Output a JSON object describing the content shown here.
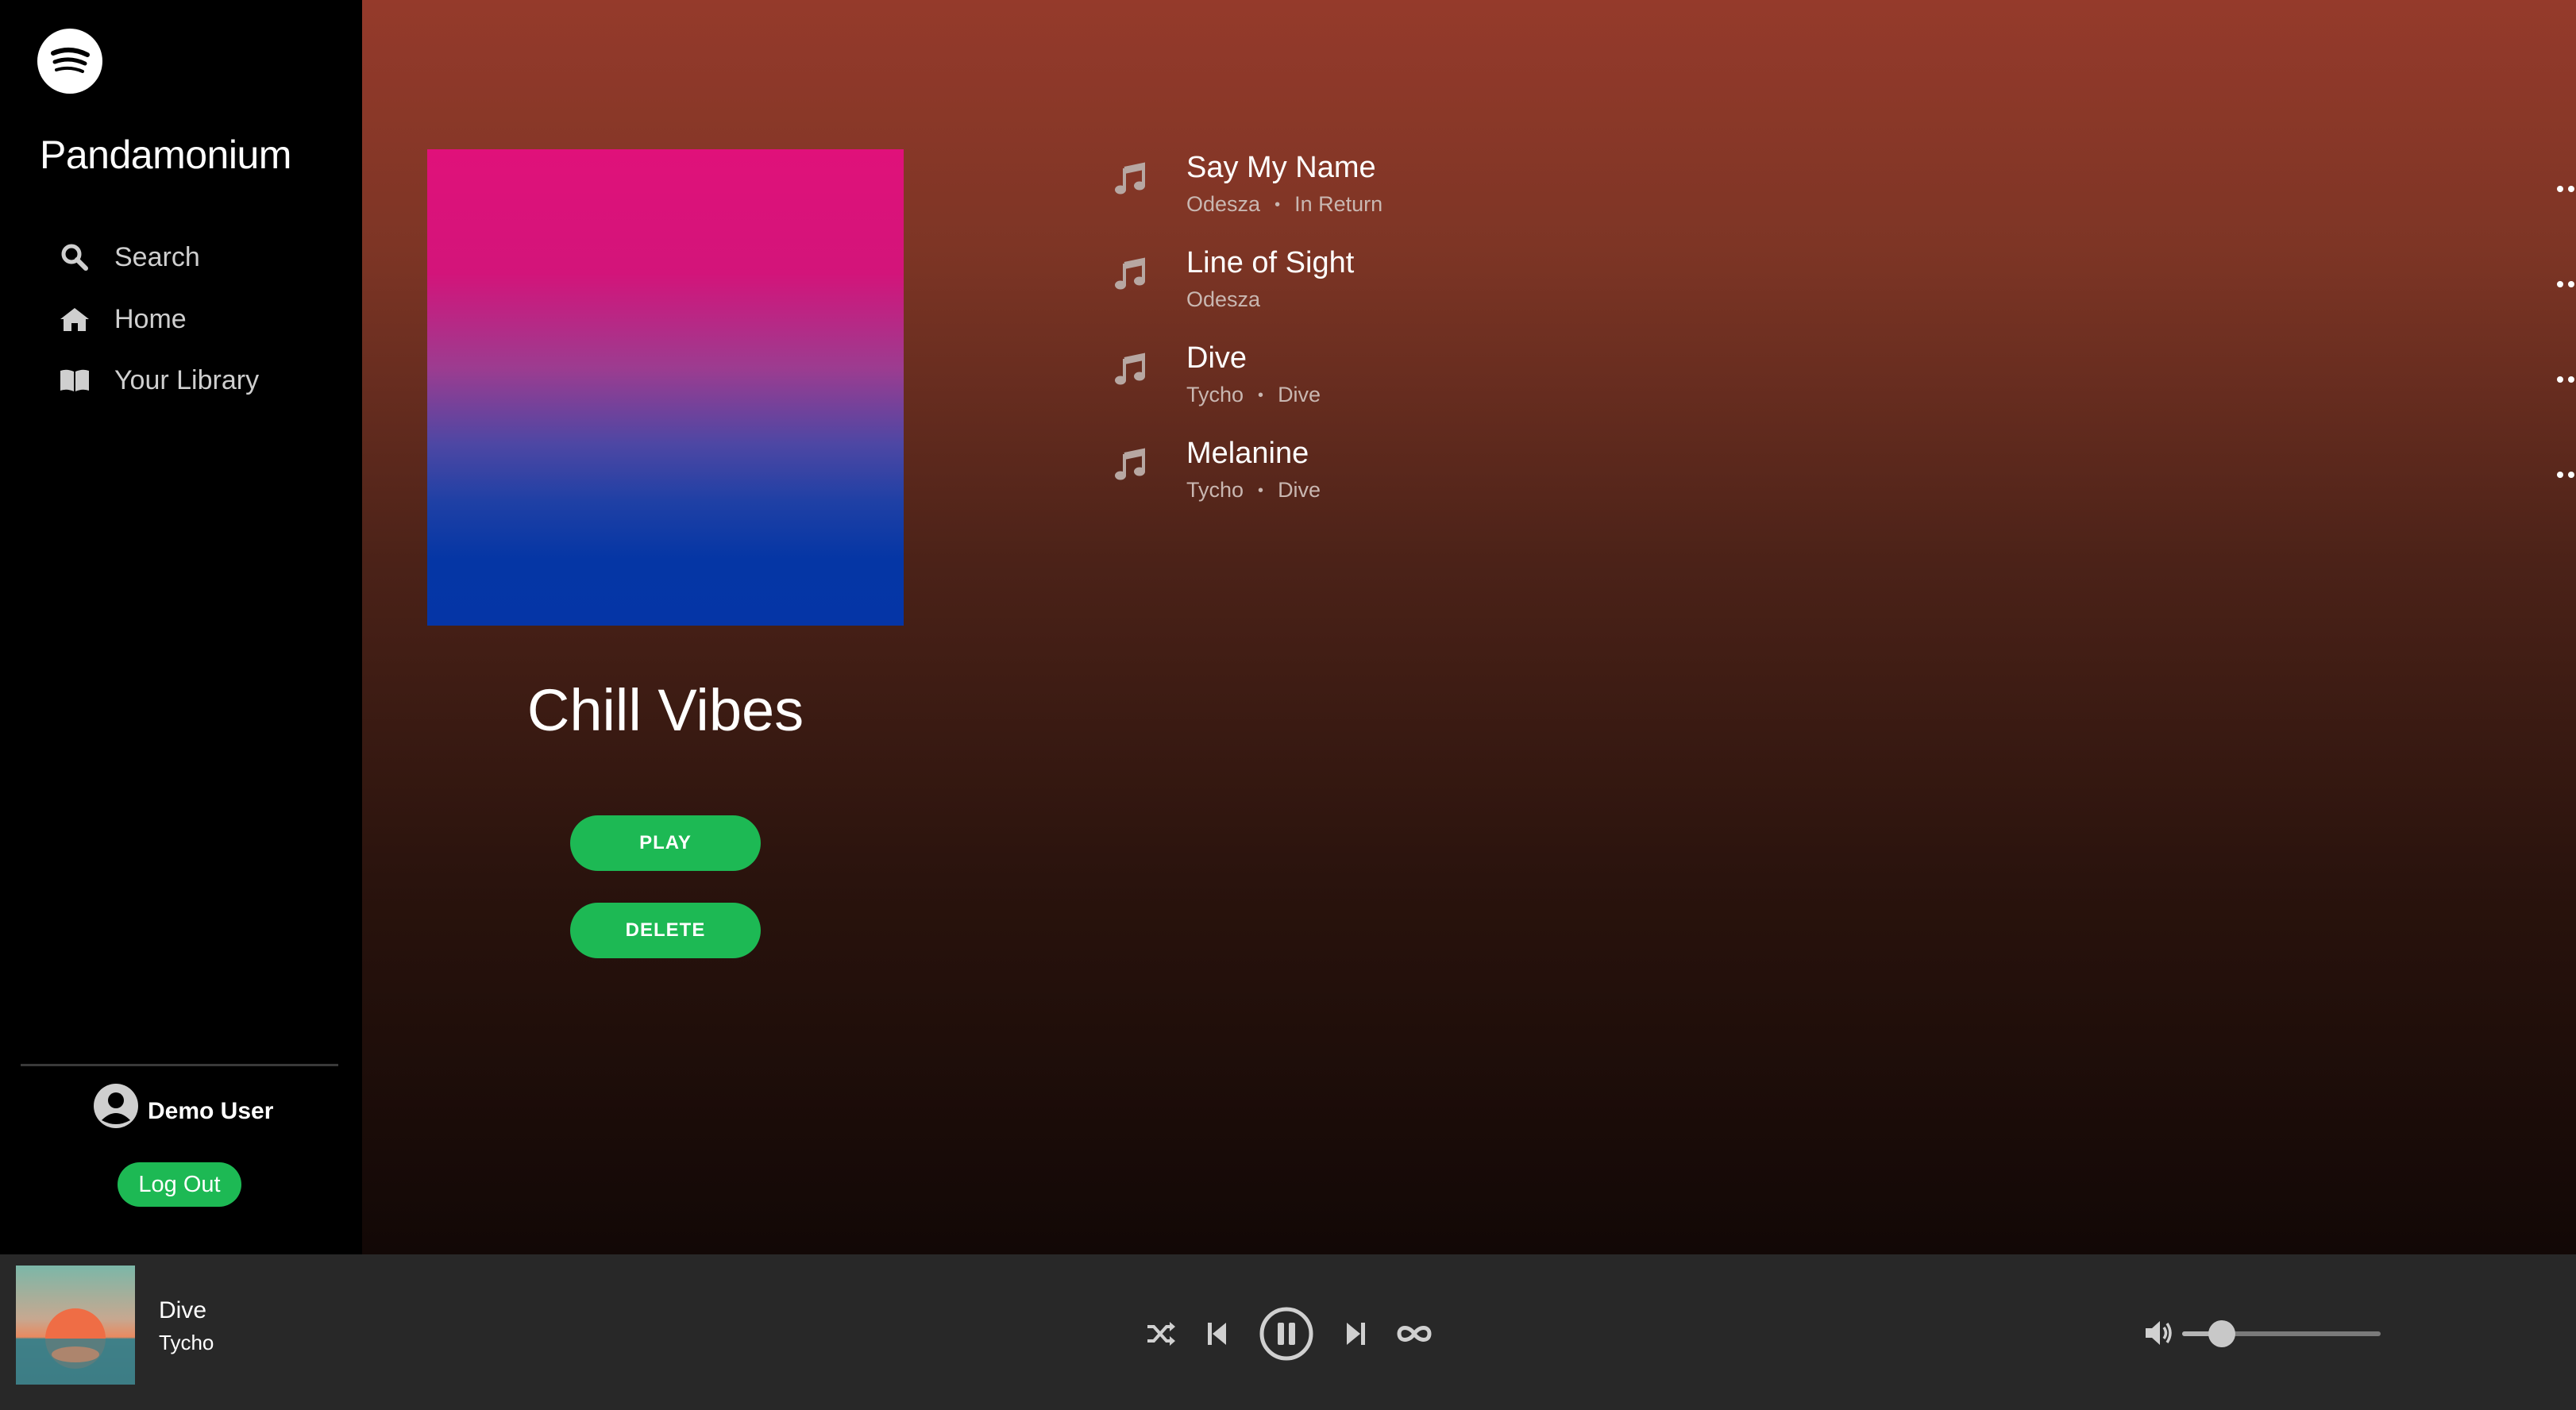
{
  "app": {
    "title": "Pandamonium"
  },
  "nav": {
    "items": [
      {
        "label": "Search",
        "icon": "search-icon"
      },
      {
        "label": "Home",
        "icon": "home-icon"
      },
      {
        "label": "Your Library",
        "icon": "library-icon"
      }
    ]
  },
  "user": {
    "name": "Demo User",
    "logout_label": "Log Out"
  },
  "playlist": {
    "title": "Chill Vibes",
    "play_label": "PLAY",
    "delete_label": "DELETE",
    "cover_colors": [
      "#e0117a",
      "#0536a5"
    ]
  },
  "tracks": [
    {
      "title": "Say My Name",
      "artist": "Odesza",
      "album": "In Return"
    },
    {
      "title": "Line of Sight",
      "artist": "Odesza",
      "album": ""
    },
    {
      "title": "Dive",
      "artist": "Tycho",
      "album": "Dive"
    },
    {
      "title": "Melanine",
      "artist": "Tycho",
      "album": "Dive"
    }
  ],
  "player": {
    "now_playing": {
      "title": "Dive",
      "artist": "Tycho"
    },
    "controls": [
      "shuffle-icon",
      "previous-icon",
      "pause-icon",
      "next-icon",
      "repeat-icon"
    ],
    "volume": 0.2
  },
  "colors": {
    "accent": "#1db954",
    "sidebar_bg": "#000000",
    "player_bg": "#282828",
    "main_gradient_top": "#953a2b",
    "main_gradient_bottom": "#120806"
  }
}
